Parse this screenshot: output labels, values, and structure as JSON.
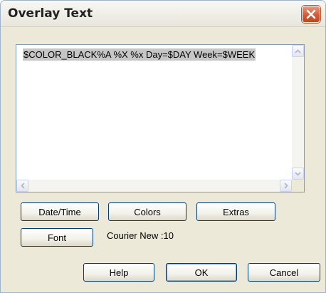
{
  "window": {
    "title": "Overlay Text",
    "close_icon": "close-icon",
    "close_color": "#d25b35"
  },
  "editor": {
    "text": "$COLOR_BLACK%A %X %x Day=$DAY Week=$WEEK",
    "selected": true
  },
  "buttons": {
    "date_time": "Date/Time",
    "colors": "Colors",
    "extras": "Extras",
    "font": "Font",
    "help": "Help",
    "ok": "OK",
    "cancel": "Cancel"
  },
  "font_info": "Courier New :10",
  "icons": {
    "scroll_up": "chevron-up-icon",
    "scroll_down": "chevron-down-icon",
    "scroll_left": "chevron-left-icon",
    "scroll_right": "chevron-right-icon"
  }
}
